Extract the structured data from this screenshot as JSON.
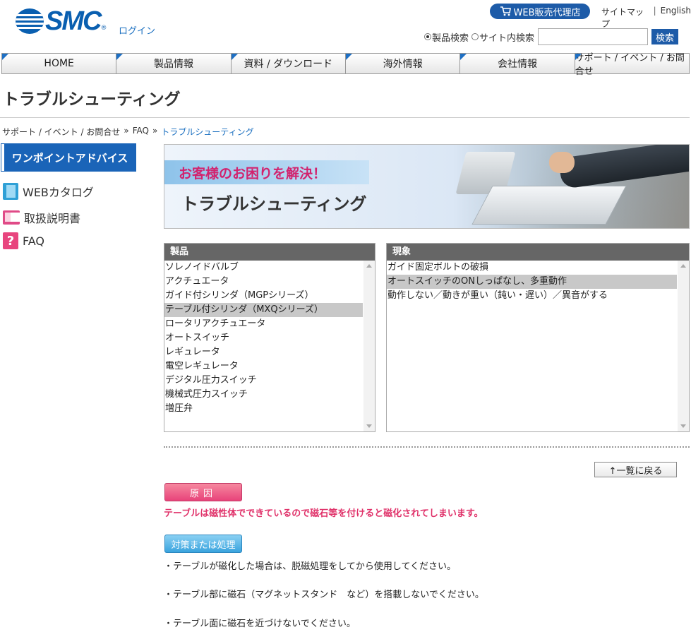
{
  "header": {
    "logo_text": "SMC",
    "logo_reg": "®",
    "login": "ログイン",
    "web_dealer": "WEB販売代理店",
    "sitemap": "サイトマップ",
    "separator": "|",
    "english": "English",
    "search": {
      "option_product": "製品検索",
      "option_site": "サイト内検索",
      "selected": "製品検索",
      "placeholder": "",
      "button": "検索"
    }
  },
  "nav": [
    "HOME",
    "製品情報",
    "資料 / ダウンロード",
    "海外情報",
    "会社情報",
    "サポート / イベント / お問合せ"
  ],
  "page_title": "トラブルシューティング",
  "breadcrumb": {
    "items": [
      "サポート / イベント / お問合せ",
      "FAQ",
      "トラブルシューティング"
    ],
    "separator": "»"
  },
  "sidebar": {
    "advice": "ワンポイントアドバイス",
    "links": [
      {
        "label": "WEBカタログ",
        "icon": "catalog-icon"
      },
      {
        "label": "取扱説明書",
        "icon": "manual-book-icon"
      },
      {
        "label": "FAQ",
        "icon": "faq-icon",
        "glyph": "?"
      }
    ]
  },
  "banner": {
    "subtitle": "お客様のお困りを解決！",
    "title": "トラブルシューティング"
  },
  "product_box": {
    "header": "製品",
    "options": [
      "ソレノイドバルブ",
      "アクチュエータ",
      "ガイド付シリンダ（MGPシリーズ）",
      "テーブル付シリンダ（MXQシリーズ）",
      "ロータリアクチュエータ",
      "オートスイッチ",
      "レギュレータ",
      "電空レギュレータ",
      "デジタル圧力スイッチ",
      "機械式圧力スイッチ",
      "増圧弁"
    ],
    "selected": "テーブル付シリンダ（MXQシリーズ）"
  },
  "symptom_box": {
    "header": "現象",
    "options": [
      "ガイド固定ボルトの破損",
      "オートスイッチのONしっぱなし、多重動作",
      "動作しない／動きが重い（鈍い・遅い）／異音がする"
    ],
    "selected": "オートスイッチのONしっぱなし、多重動作"
  },
  "back_button": "↑一覧に戻る",
  "cause": {
    "badge": "原因",
    "text": "テーブルは磁性体でできているので磁石等を付けると磁化されてしまいます。"
  },
  "measures": {
    "badge": "対策または処理",
    "items": [
      "・テーブルが磁化した場合は、脱磁処理をしてから使用してください。",
      "・テーブル部に磁石（マグネットスタンド　など）を搭載しないでください。",
      "・テーブル面に磁石を近づけないでください。"
    ]
  },
  "colors": {
    "brand_blue": "#1d5ba8",
    "cause_pink": "#e0326a",
    "measure_blue": "#3aa4de",
    "selected_row": "#c8c8c8"
  }
}
